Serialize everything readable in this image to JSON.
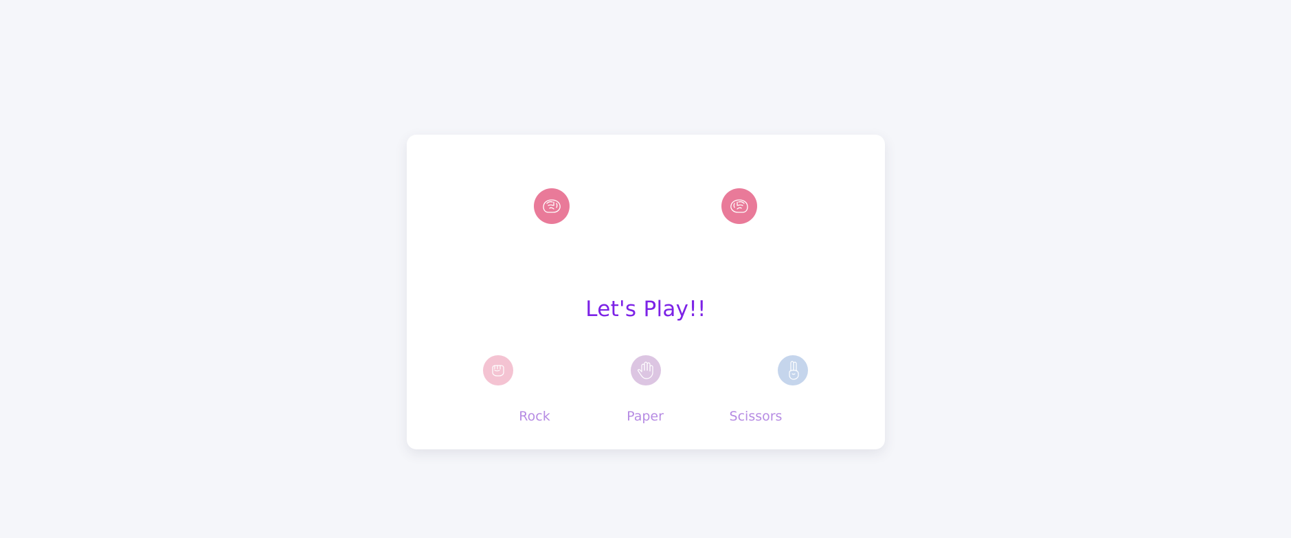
{
  "game": {
    "status_text": "Let's Play!!",
    "player_hand": {
      "icon": "rock-hand-icon",
      "color": "#e97a99"
    },
    "computer_hand": {
      "icon": "rock-hand-icon",
      "color": "#e97a99"
    },
    "choices": [
      {
        "label": "Rock",
        "icon": "rock-hand-icon",
        "color": "#f4c3d2"
      },
      {
        "label": "Paper",
        "icon": "paper-hand-icon",
        "color": "#dcc5e2"
      },
      {
        "label": "Scissors",
        "icon": "scissors-hand-icon",
        "color": "#c5d5ec"
      }
    ],
    "accent_color": "#7c22e6",
    "label_color": "#b68be3"
  }
}
